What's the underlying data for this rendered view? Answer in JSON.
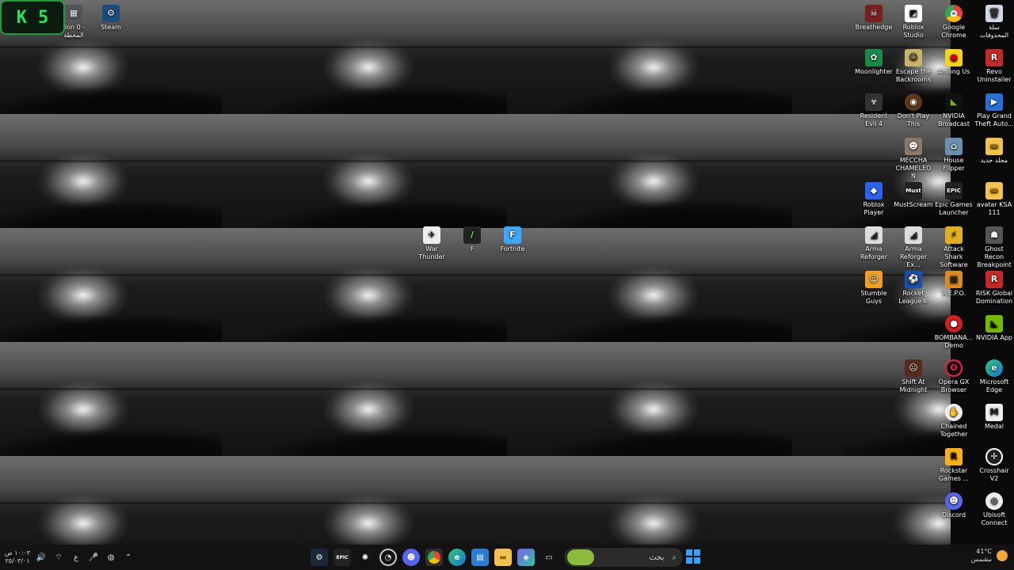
{
  "overlay": {
    "left": "K",
    "right": "5"
  },
  "desktop_icons": {
    "edition": "tion 0 - المحطة",
    "steam": "Steam",
    "breathedge": "Breathedge",
    "roblox_studio": "Roblox Studio",
    "google_chrome": "Google Chrome",
    "recycle_bin": "سلة المحذوفات",
    "moonlighter": "Moonlighter",
    "escape_backrooms": "Escape the Backrooms",
    "among_us": "Among Us",
    "revo": "Revo Uninstaller",
    "resident_evil": "Resident Evil 4",
    "dont_play_this": "Don't Play This",
    "nvidia_broadcast": "NVIDIA Broadcast",
    "gta": "Play Grand Theft Auto...",
    "meccha": "MECCHA CHAMELEON",
    "house_flipper": "House Flipper",
    "new_folder": "مجلد جديد",
    "roblox_player": "Roblox Player",
    "mustscream": "MustScream",
    "epic": "Epic Games Launcher",
    "avatar_ksa": "avatar KSA 111",
    "war_thunder": "War Thunder",
    "f": "F",
    "fortnite": "Fortnite",
    "arma_reforger": "Arma Reforger",
    "arma_reforger_ex": "Arma Reforger Ex...",
    "attack_shark": "Attack Shark Software",
    "ghost_recon": "Ghost Recon Breakpoint",
    "stumble_guys": "Stumble Guys",
    "rocket_league": "Rocket League®",
    "repo": "R.E.P.O.",
    "risk": "RISK Global Domination",
    "bombana": "BOMBANA... Demo",
    "nvidia_app": "NVIDIA App",
    "shift_at_midnight": "Shift At Midnight",
    "opera_gx": "Opera GX Browser",
    "edge": "Microsoft Edge",
    "chained_together": "Chained Together",
    "medal": "Medal",
    "rockstar": "Rockstar Games ...",
    "crosshair": "Crosshair V2",
    "discord": "Discord",
    "ubisoft": "Ubisoft Connect"
  },
  "taskbar": {
    "time": "١٠:٠٣ ص",
    "date": "٢٥/٠٣/٠١",
    "lang": "ع",
    "search_placeholder": "بحث",
    "temperature": "41°C",
    "weather_condition": "مشمس",
    "apps": [
      "steam",
      "epic",
      "steelseries",
      "clock-app",
      "discord",
      "chrome",
      "edge",
      "store",
      "file-explorer",
      "teams-copilot",
      "task-view"
    ]
  }
}
